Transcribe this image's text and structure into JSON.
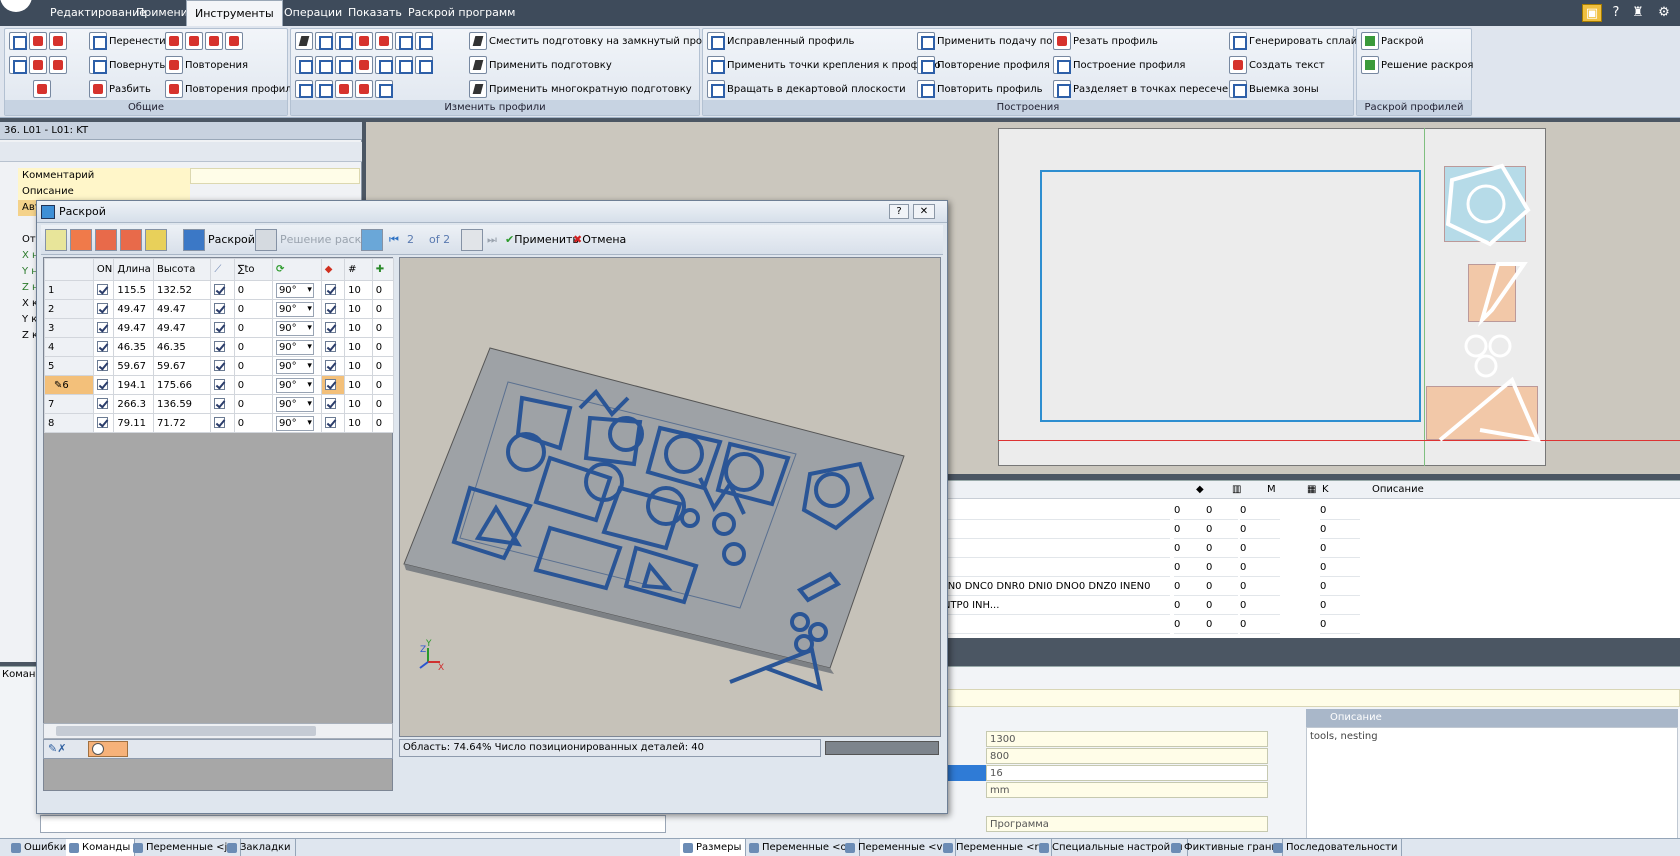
{
  "menu": {
    "items": [
      "Редактирование",
      "Применить",
      "Инструменты",
      "Операции",
      "Показать",
      "Раскрой программ"
    ],
    "active": "Инструменты"
  },
  "ribbon": {
    "groups": [
      "Общие",
      "Изменить профили",
      "Построения",
      "Раскрой профилей"
    ],
    "general": [
      "Перенести",
      "Повернуть",
      "Разбить",
      "Повторения",
      "Повторения профиля"
    ],
    "modify": [
      "Сместить подготовку на замкнутый профиль",
      "Применить подготовку",
      "Применить многократную подготовку"
    ],
    "build_col1": [
      "Исправленный профиль",
      "Применить точки крепления к профилю",
      "Вращать в декартовой плоскости"
    ],
    "build_col2": [
      "Применить подачу по Z",
      "Повторение профиля",
      "Повторить профиль"
    ],
    "build_col3": [
      "Резать профиль",
      "Построение профиля",
      "Разделяет в точках пересечения"
    ],
    "build_col4": [
      "Генерировать сплайн",
      "Создать текст",
      "Выемка зоны"
    ],
    "nest": [
      "Раскрой",
      "Решение раскроя"
    ]
  },
  "left_panel": {
    "title": "36. L01 - L01: KT",
    "rows": [
      "Комментарий",
      "Описание",
      "Авто",
      "Отм",
      "X н",
      "Y н",
      "Z н",
      "X к",
      "Y к",
      "Z к"
    ]
  },
  "dialog": {
    "title": "Раскрой",
    "toolbar": {
      "nest": "Раскрой",
      "solution": "Решение раскроя",
      "index": "2",
      "of": "of 2",
      "apply": "Применить",
      "cancel": "Отмена"
    },
    "columns": [
      "",
      "ON",
      "Длина",
      "Высота",
      "",
      "∑to",
      "",
      "",
      "#",
      ""
    ],
    "rows": [
      {
        "n": "1",
        "on": true,
        "len": "115.5",
        "h": "132.52",
        "c": true,
        "to": "0",
        "ang": "90°",
        "r": true,
        "q": "10",
        "x": "0"
      },
      {
        "n": "2",
        "on": true,
        "len": "49.47",
        "h": "49.47",
        "c": true,
        "to": "0",
        "ang": "90°",
        "r": true,
        "q": "10",
        "x": "0"
      },
      {
        "n": "3",
        "on": true,
        "len": "49.47",
        "h": "49.47",
        "c": true,
        "to": "0",
        "ang": "90°",
        "r": true,
        "q": "10",
        "x": "0"
      },
      {
        "n": "4",
        "on": true,
        "len": "46.35",
        "h": "46.35",
        "c": true,
        "to": "0",
        "ang": "90°",
        "r": true,
        "q": "10",
        "x": "0"
      },
      {
        "n": "5",
        "on": true,
        "len": "59.67",
        "h": "59.67",
        "c": true,
        "to": "0",
        "ang": "90°",
        "r": true,
        "q": "10",
        "x": "0"
      },
      {
        "n": "6",
        "on": true,
        "len": "194.1",
        "h": "175.66",
        "c": true,
        "to": "0",
        "ang": "90°",
        "r": true,
        "q": "10",
        "x": "0"
      },
      {
        "n": "7",
        "on": true,
        "len": "266.3",
        "h": "136.59",
        "c": true,
        "to": "0",
        "ang": "90°",
        "r": true,
        "q": "10",
        "x": "0"
      },
      {
        "n": "8",
        "on": true,
        "len": "79.11",
        "h": "71.72",
        "c": true,
        "to": "0",
        "ang": "90°",
        "r": true,
        "q": "10",
        "x": "0"
      }
    ],
    "status": "Область: 74.64%  Число позиционированных деталей: 40"
  },
  "lower_grid": {
    "headers": [
      "M",
      "K",
      "Описание"
    ],
    "rows": [
      {
        "a": "0",
        "b": "0",
        "m": "0",
        "k": "0",
        "text": ""
      },
      {
        "a": "0",
        "b": "0",
        "m": "0",
        "k": "0",
        "text": ""
      },
      {
        "a": "0",
        "b": "0",
        "m": "0",
        "k": "0",
        "text": ""
      },
      {
        "a": "0",
        "b": "0",
        "m": "0",
        "k": "0",
        "text": ""
      },
      {
        "a": "0",
        "b": "0",
        "m": "0",
        "k": "0",
        "text": "DN0 DNC0 DNR0 DNI0 DNO0 DNZ0 INEN0 INTP0 INH..."
      },
      {
        "a": "0",
        "b": "0",
        "m": "0",
        "k": "0",
        "text": ""
      },
      {
        "a": "0",
        "b": "0",
        "m": "0",
        "k": "0",
        "text": ""
      }
    ]
  },
  "props": {
    "fields": [
      "1300",
      "800",
      "16",
      "mm",
      "Программа"
    ],
    "desc_title": "Описание",
    "desc_text": "tools, nesting",
    "cmd_tab": "Коман"
  },
  "status_tabs_left": [
    "Ошибки",
    "Команды",
    "Переменные <j>",
    "Закладки"
  ],
  "status_tabs_right": [
    "Размеры",
    "Переменные <o>",
    "Переменные <v>",
    "Переменные <r>",
    "Специальные настройки",
    "Фиктивные грани",
    "Последовательности"
  ]
}
